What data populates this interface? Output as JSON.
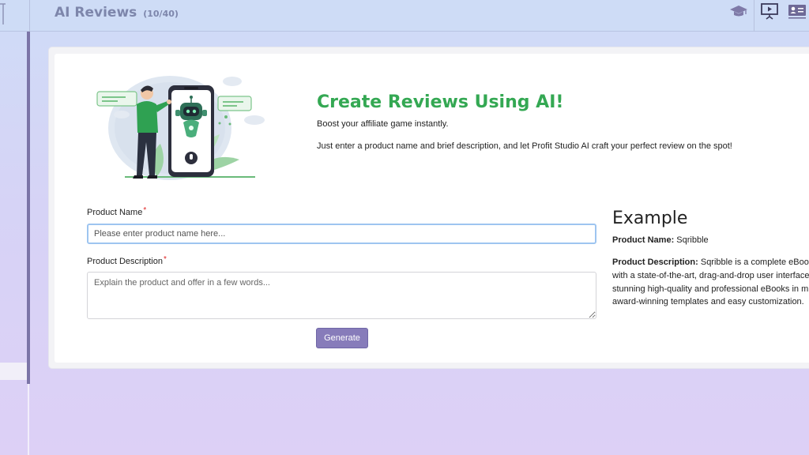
{
  "header": {
    "title": "AI Reviews",
    "count": "(10/40)",
    "icons": [
      "graduation-cap-icon",
      "presentation-icon",
      "contact-card-icon"
    ]
  },
  "hero": {
    "title": "Create Reviews Using AI!",
    "subtitle": "Boost your affiliate game instantly.",
    "description": "Just enter a product name and brief description, and let Profit Studio AI craft your perfect review on the spot!"
  },
  "form": {
    "name_label": "Product Name",
    "required_mark": "*",
    "name_placeholder": "Please enter product name here...",
    "name_value": "",
    "desc_label": "Product Description",
    "desc_placeholder": "Explain the product and offer in a few words...",
    "desc_value": "",
    "generate_label": "Generate"
  },
  "example": {
    "title": "Example",
    "name_key": "Product Name:",
    "name_value": " Sqribble",
    "desc_key": "Product Description:",
    "desc_lines": [
      " Sqribble is a complete eBook c",
      "with a state-of-the-art, drag-and-drop user interface",
      "stunning high-quality and professional eBooks in min",
      "award-winning templates and easy customization."
    ]
  },
  "colors": {
    "accent_green": "#34a853",
    "button_purple": "#877cba",
    "title_gray": "#7d86ab"
  }
}
